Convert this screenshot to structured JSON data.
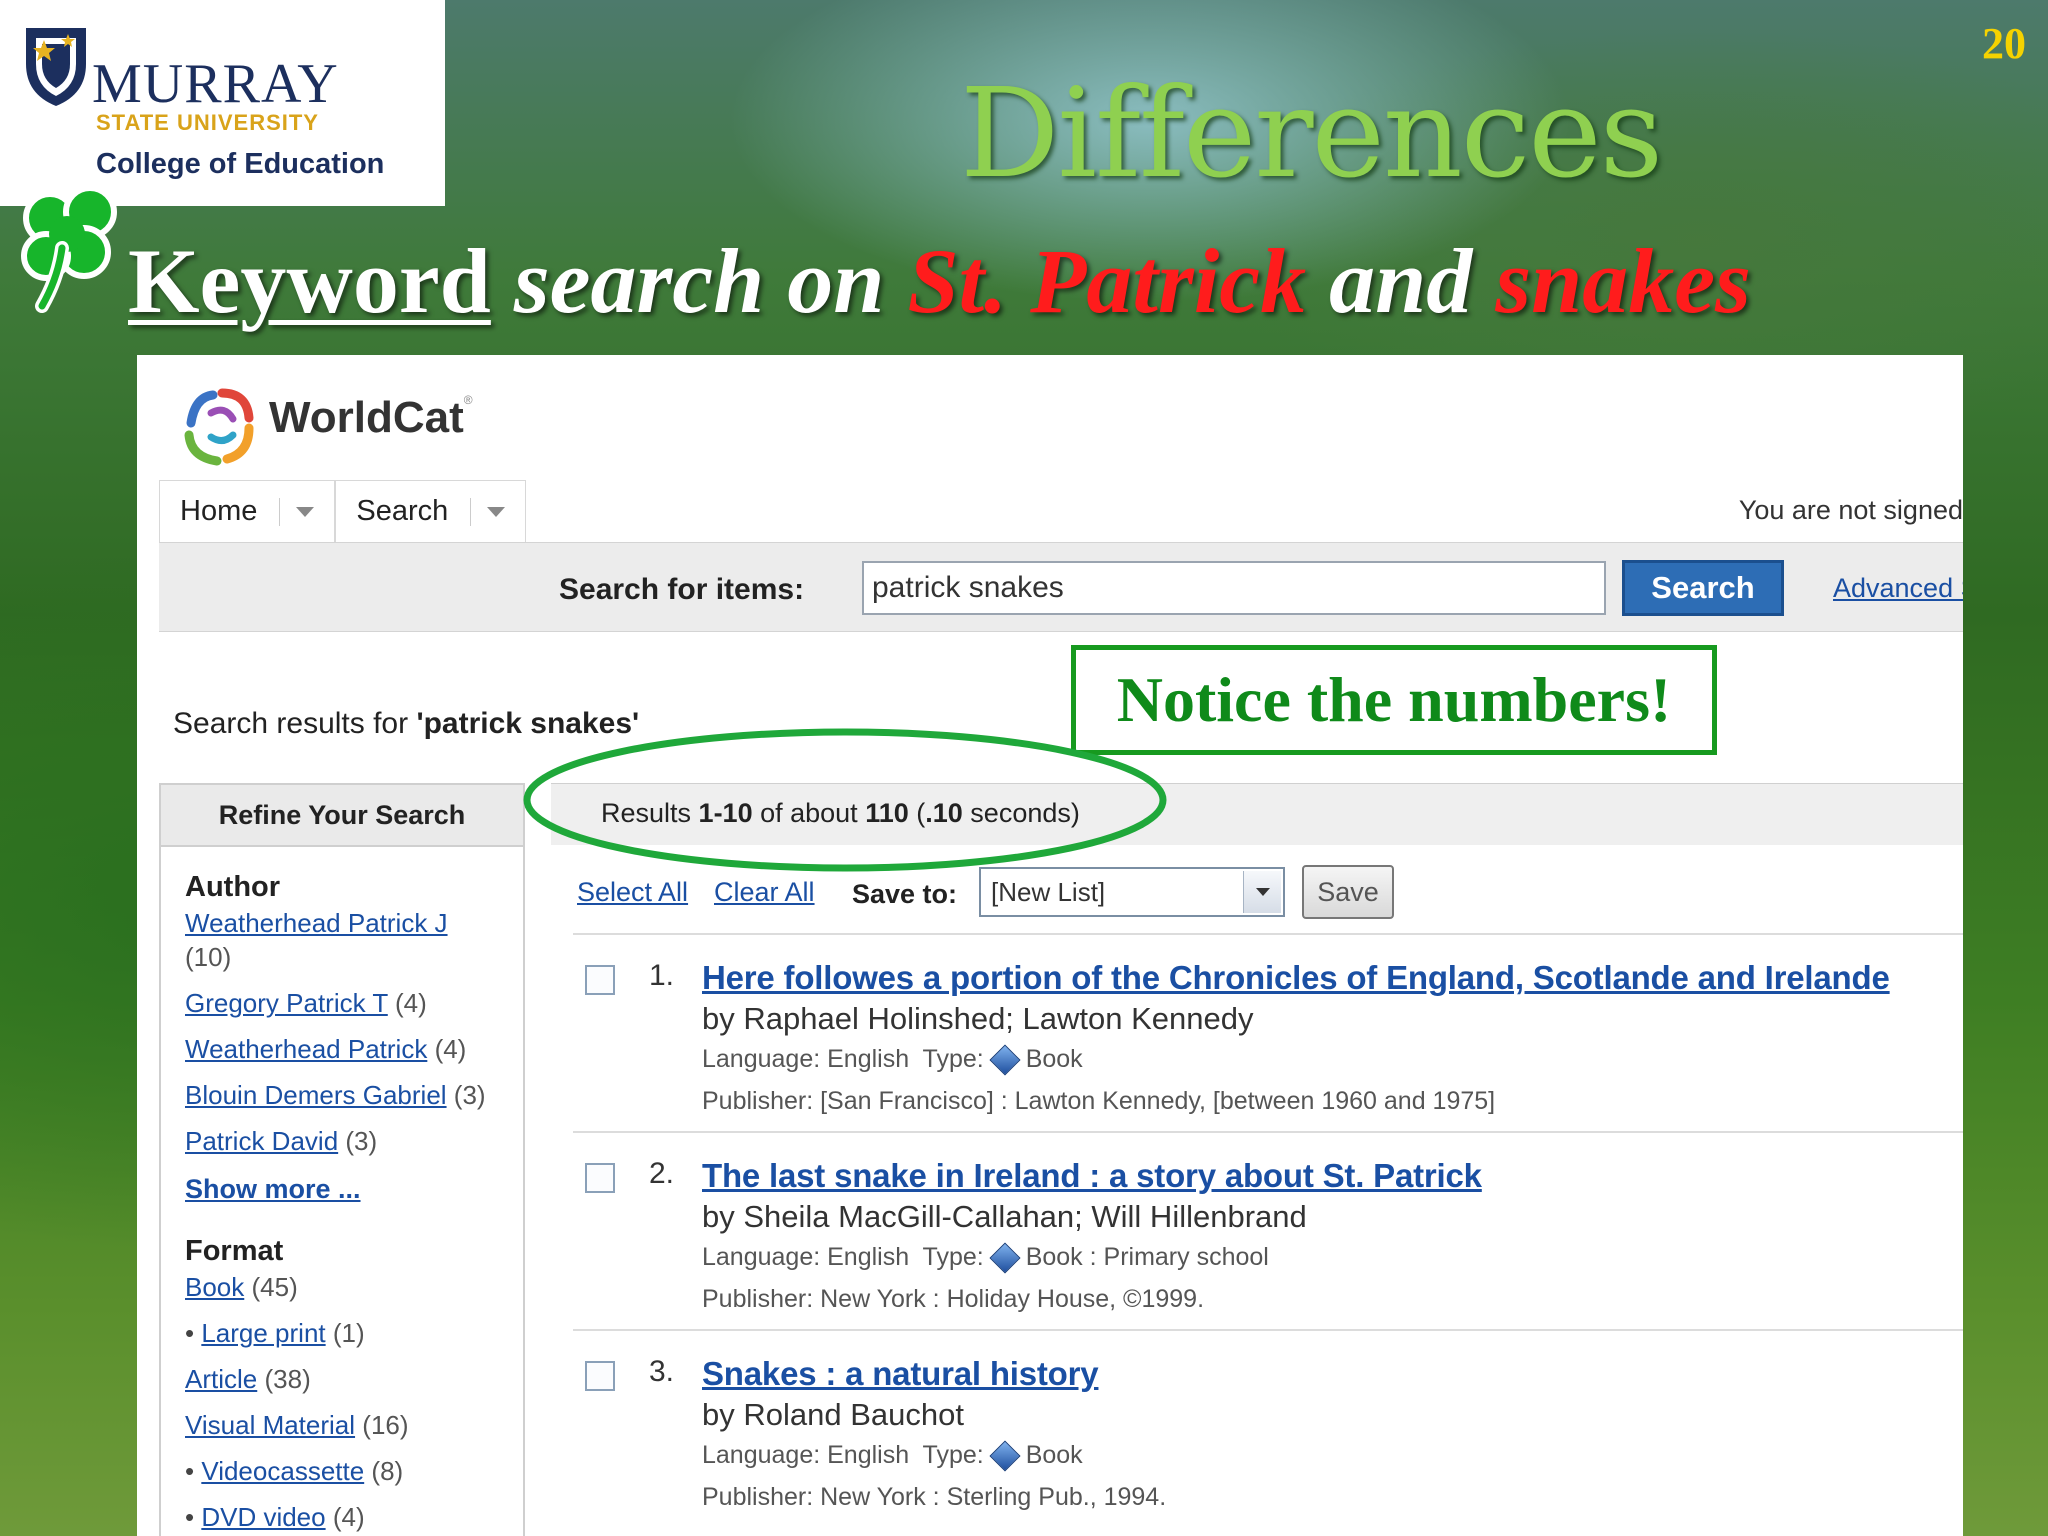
{
  "slide": {
    "number": "20",
    "title": "Differences",
    "subtitle_parts": {
      "keyword": "Keyword",
      "mid1": " search on ",
      "st_patrick": "St. Patrick",
      "mid2": " and ",
      "snakes": "snakes"
    },
    "logo": {
      "murray": "MURRAY",
      "state": "STATE UNIVERSITY",
      "college": "College of Education"
    },
    "annotation": "Notice the numbers!",
    "colors": {
      "title": "#8fd050",
      "highlight": "#ff1c1c",
      "annotation": "#179a1f"
    }
  },
  "worldcat": {
    "brand": "WorldCat",
    "tabs": [
      "Home",
      "Search"
    ],
    "signed_status": "You are not signed",
    "search": {
      "label": "Search for items:",
      "value": "patrick snakes",
      "button": "Search",
      "advanced": "Advanced Se"
    },
    "results_for": {
      "prefix": "Search results for ",
      "query": "'patrick snakes'"
    },
    "results_count": {
      "pre": "Results ",
      "range": "1-10",
      "mid": " of about ",
      "total": "110",
      "time_pre": " (",
      "time": ".10",
      "time_post": " seconds)"
    },
    "actions": {
      "select_all": "Select All",
      "clear_all": "Clear All",
      "save_to_label": "Save to:",
      "list_value": "[New List]",
      "save_button": "Save"
    },
    "refine": {
      "heading": "Refine Your Search",
      "author": {
        "heading": "Author",
        "items": [
          {
            "name": "Weatherhead Patrick J",
            "count": "(10)"
          },
          {
            "name": "Gregory Patrick T",
            "count": "(4)"
          },
          {
            "name": "Weatherhead Patrick",
            "count": "(4)"
          },
          {
            "name": "Blouin Demers Gabriel",
            "count": "(3)"
          },
          {
            "name": "Patrick David",
            "count": "(3)"
          }
        ],
        "show_more": "Show more ..."
      },
      "format": {
        "heading": "Format",
        "items": [
          {
            "name": "Book",
            "count": "(45)"
          },
          {
            "name": "Large print",
            "count": "(1)"
          },
          {
            "name": "Article",
            "count": "(38)"
          },
          {
            "name": "Visual Material",
            "count": "(16)"
          },
          {
            "name": "Videocassette",
            "count": "(8)"
          },
          {
            "name": "DVD video",
            "count": "(4)"
          }
        ]
      }
    },
    "results": [
      {
        "num": "1.",
        "title": "Here followes a portion of the Chronicles of England, Scotlande and Irelande",
        "authors": "by Raphael Holinshed; Lawton Kennedy",
        "lang": "Language: English  Type:",
        "type": "Book",
        "publisher": "Publisher: [San Francisco] : Lawton Kennedy, [between 1960 and 1975]"
      },
      {
        "num": "2.",
        "title": "The last snake in Ireland : a story about St. Patrick",
        "authors": "by Sheila MacGill-Callahan; Will Hillenbrand",
        "lang": "Language: English  Type:",
        "type": "Book : Primary school",
        "publisher": "Publisher: New York : Holiday House, ©1999."
      },
      {
        "num": "3.",
        "title": "Snakes : a natural history",
        "authors": "by Roland Bauchot",
        "lang": "Language: English  Type:",
        "type": "Book",
        "publisher": "Publisher: New York : Sterling Pub., 1994."
      }
    ]
  }
}
